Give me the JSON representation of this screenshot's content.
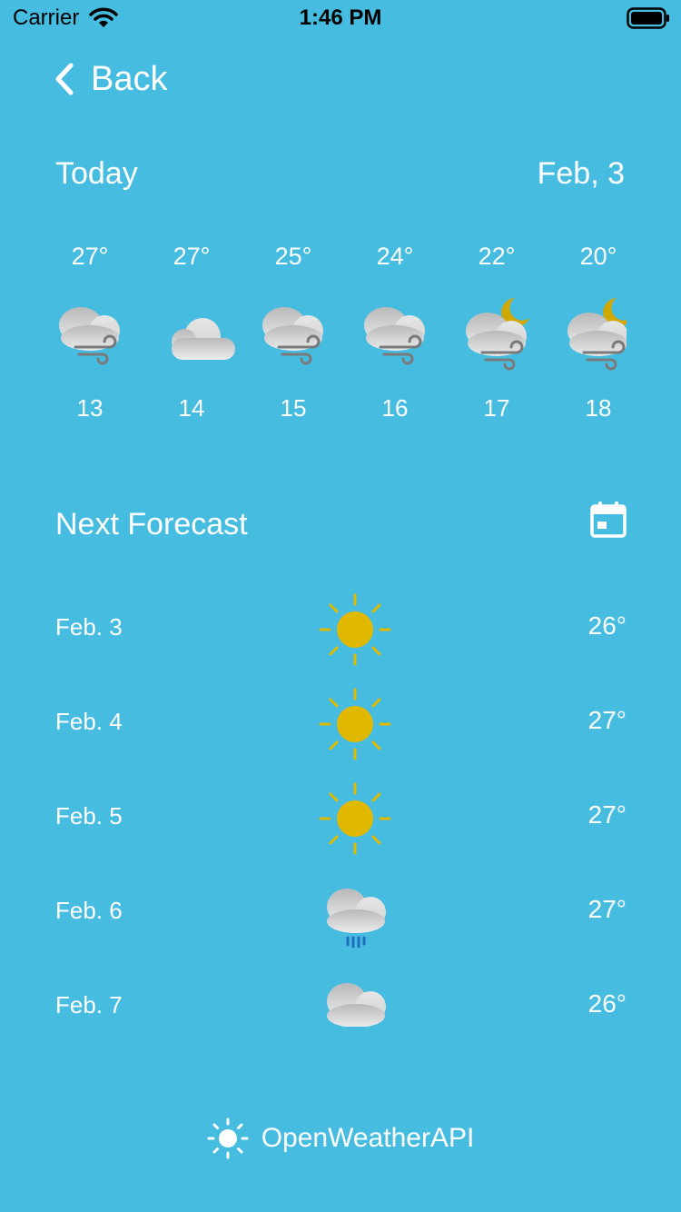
{
  "status_bar": {
    "carrier": "Carrier",
    "time": "1:46 PM"
  },
  "nav": {
    "back_label": "Back"
  },
  "today": {
    "title": "Today",
    "date": "Feb, 3",
    "hours": [
      {
        "temp": "27°",
        "label": "13",
        "icon": "cloud-wind-icon"
      },
      {
        "temp": "27°",
        "label": "14",
        "icon": "cloud-icon"
      },
      {
        "temp": "25°",
        "label": "15",
        "icon": "cloud-wind-icon"
      },
      {
        "temp": "24°",
        "label": "16",
        "icon": "cloud-wind-icon"
      },
      {
        "temp": "22°",
        "label": "17",
        "icon": "moon-cloud-wind-icon"
      },
      {
        "temp": "20°",
        "label": "18",
        "icon": "moon-cloud-wind-icon"
      }
    ]
  },
  "next_forecast": {
    "title": "Next Forecast",
    "days": [
      {
        "date": "Feb. 3",
        "temp": "26°",
        "icon": "sun-icon"
      },
      {
        "date": "Feb. 4",
        "temp": "27°",
        "icon": "sun-icon"
      },
      {
        "date": "Feb. 5",
        "temp": "27°",
        "icon": "sun-icon"
      },
      {
        "date": "Feb. 6",
        "temp": "27°",
        "icon": "cloud-rain-icon"
      },
      {
        "date": "Feb. 7",
        "temp": "26°",
        "icon": "cloud-rain-icon"
      }
    ]
  },
  "footer": {
    "label": "OpenWeatherAPI"
  },
  "colors": {
    "background": "#46bde0",
    "sun": "#e0b800",
    "cloud": "#c9c9c9",
    "rain": "#1f6fbf"
  }
}
